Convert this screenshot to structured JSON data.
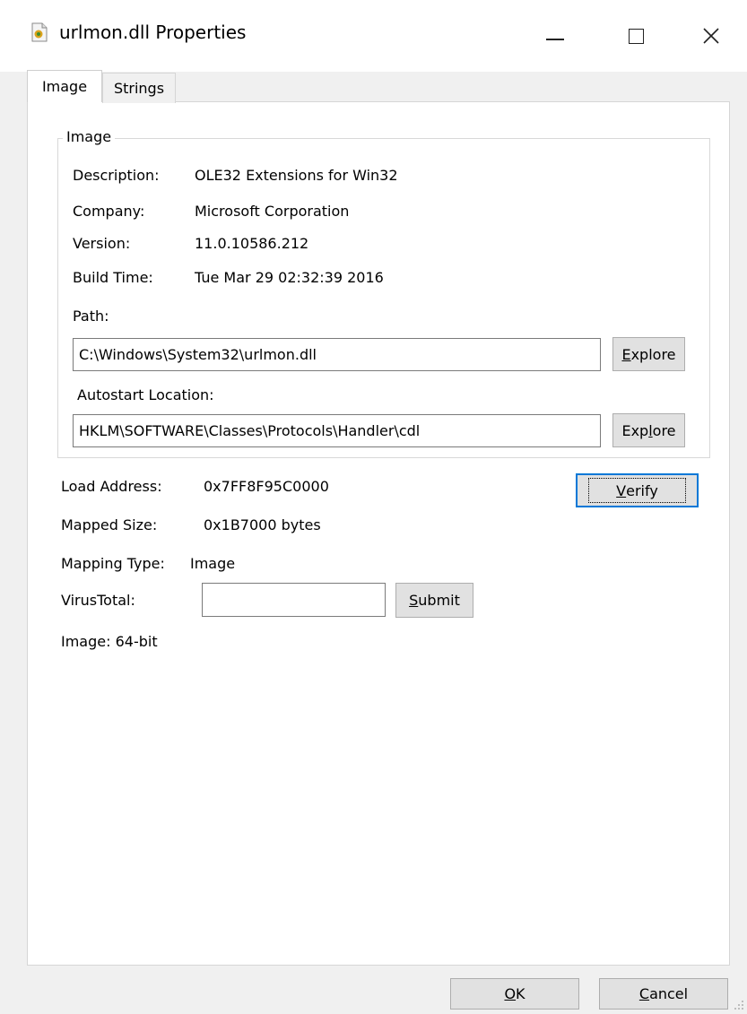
{
  "window": {
    "title": "urlmon.dll Properties"
  },
  "tabs": [
    {
      "label": "Image",
      "selected": true
    },
    {
      "label": "Strings",
      "selected": false
    }
  ],
  "image_group": {
    "legend": "Image",
    "rows": [
      {
        "label": "Description:",
        "value": "OLE32 Extensions for Win32"
      },
      {
        "label": "Company:",
        "value": "Microsoft Corporation"
      },
      {
        "label": "Version:",
        "value": "11.0.10586.212"
      },
      {
        "label": "Build Time:",
        "value": "Tue Mar 29 02:32:39 2016"
      }
    ],
    "path": {
      "label": "Path:",
      "value": "C:\\Windows\\System32\\urlmon.dll",
      "button": {
        "pre": "",
        "mnemonic": "E",
        "post": "xplore"
      }
    },
    "autostart": {
      "label": "Autostart Location:",
      "value": "HKLM\\SOFTWARE\\Classes\\Protocols\\Handler\\cdl",
      "button": {
        "pre": "Exp",
        "mnemonic": "l",
        "post": "ore"
      }
    }
  },
  "details": [
    {
      "label": "Load Address:",
      "value": "0x7FF8F95C0000"
    },
    {
      "label": "Mapped Size:",
      "value": "0x1B7000 bytes"
    },
    {
      "label": "Mapping Type:",
      "value": "Image"
    }
  ],
  "verify_button": {
    "pre": "",
    "mnemonic": "V",
    "post": "erify"
  },
  "virustotal": {
    "label": "VirusTotal:",
    "value": "",
    "button": {
      "pre": "",
      "mnemonic": "S",
      "post": "ubmit"
    }
  },
  "bitness": "Image: 64-bit",
  "footer": {
    "ok": {
      "pre": "",
      "mnemonic": "O",
      "post": "K"
    },
    "cancel": {
      "pre": "",
      "mnemonic": "C",
      "post": "ancel"
    }
  },
  "colors": {
    "focus_border": "#0078d7",
    "window_bg": "#f0f0f0",
    "panel_bg": "#ffffff"
  }
}
